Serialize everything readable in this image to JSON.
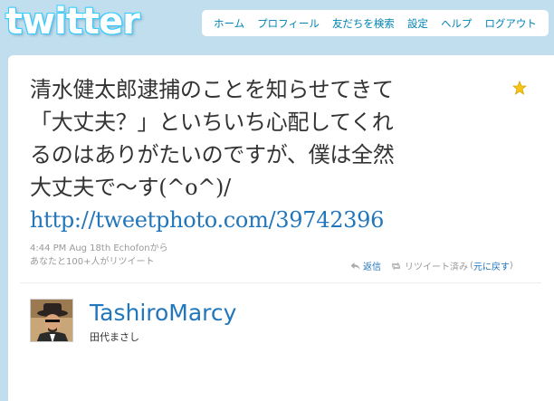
{
  "header": {
    "logo_text": "twitter",
    "nav": [
      "ホーム",
      "プロフィール",
      "友だちを検索",
      "設定",
      "ヘルプ",
      "ログアウト"
    ]
  },
  "tweet": {
    "lines": [
      "清水健太郎逮捕のことを知らせてきて",
      "「大丈夫？」といちいち心配してくれ",
      "るのはありがたいのですが、僕は全然",
      "大丈夫で〜す(^o^)/"
    ],
    "link": "http://tweetphoto.com/39742396",
    "meta_line1": "4:44 PM Aug 18th Echofonから",
    "meta_line2": "あなたと100+人がリツイート",
    "reply_label": "返信",
    "retweeted_label": "リツイート済み",
    "undo_label": "元に戻す"
  },
  "author": {
    "screen_name": "TashiroMarcy",
    "full_name": "田代まさし"
  },
  "colors": {
    "background": "#c0deed",
    "link": "#2276bb",
    "nav_link": "#0084b4",
    "star": "#f5c518"
  },
  "icons": [
    "star-icon",
    "reply-icon",
    "retweet-icon",
    "avatar"
  ]
}
